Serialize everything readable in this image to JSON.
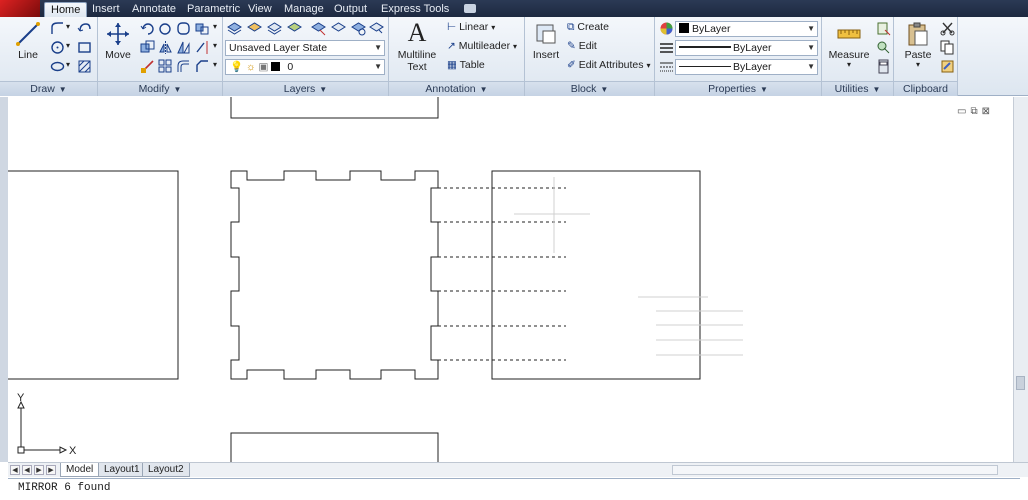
{
  "tabs": [
    "Home",
    "Insert",
    "Annotate",
    "Parametric",
    "View",
    "Manage",
    "Output",
    "Express Tools"
  ],
  "active_tab": "Home",
  "panels": {
    "draw": {
      "title": "Draw",
      "line_label": "Line"
    },
    "modify": {
      "title": "Modify",
      "move_label": "Move"
    },
    "layers": {
      "title": "Layers",
      "layer_state": "Unsaved Layer State",
      "current_layer": "0"
    },
    "annotation": {
      "title": "Annotation",
      "multiline_text": [
        "Multiline",
        "Text"
      ],
      "linear": "Linear",
      "multileader": "Multileader",
      "table": "Table"
    },
    "block": {
      "title": "Block",
      "insert": "Insert",
      "create": "Create",
      "edit": "Edit",
      "edit_attributes": "Edit Attributes"
    },
    "properties": {
      "title": "Properties",
      "color": "ByLayer",
      "linetype": "ByLayer",
      "lineweight": "ByLayer"
    },
    "utilities": {
      "title": "Utilities",
      "measure": "Measure"
    },
    "clipboard": {
      "title": "Clipboard",
      "paste": "Paste"
    }
  },
  "layout_tabs": [
    "Model",
    "Layout1",
    "Layout2"
  ],
  "active_layout": "Model",
  "ucs": {
    "x": "X",
    "y": "Y"
  },
  "command_line": "MIRROR 6 found",
  "colors": {
    "ribbon_bg": "#e6edf5",
    "tabbar_bg": "#26344d",
    "logo": "#c81e1e"
  }
}
